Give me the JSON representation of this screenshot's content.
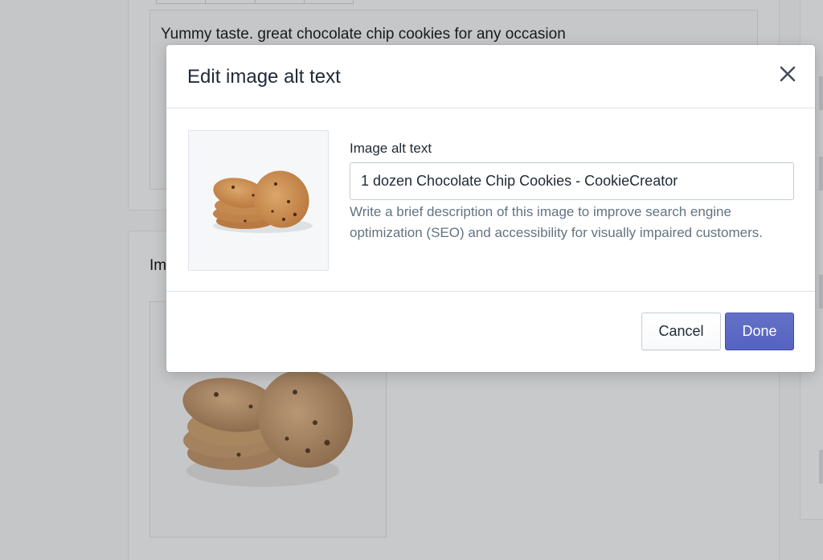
{
  "background": {
    "editor_text": "Yummy taste. great chocolate chip cookies for any occasion",
    "section_title": "Im"
  },
  "modal": {
    "title": "Edit image alt text",
    "close_icon": "close-icon",
    "field_label": "Image alt text",
    "input_value": "1 dozen Chocolate Chip Cookies - CookieCreator",
    "help_text": "Write a brief description of this image to improve search engine optimization (SEO) and accessibility for visually impaired customers.",
    "cancel_label": "Cancel",
    "done_label": "Done",
    "thumbnail": "cookies-image"
  },
  "colors": {
    "overlay_bg": "#c5c6c8",
    "primary": "#5c6ac4",
    "help_text": "#637381",
    "border": "#dfe3e8"
  }
}
